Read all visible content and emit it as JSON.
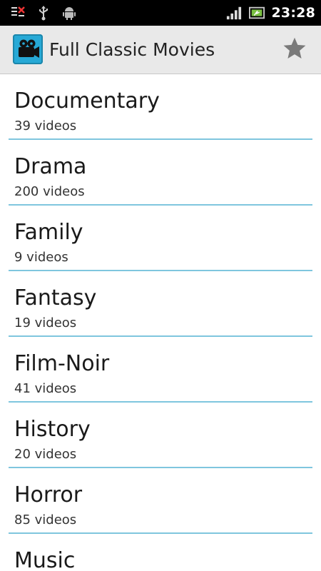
{
  "status_bar": {
    "time": "23:28",
    "icons": [
      "notification-icon",
      "usb-icon",
      "android-debug-icon",
      "signal-icon",
      "battery-icon"
    ]
  },
  "action_bar": {
    "title": "Full Classic Movies",
    "app_icon": "movie-camera-icon",
    "favorite_icon": "star-icon"
  },
  "colors": {
    "accent_divider": "#7fc6de",
    "app_icon_bg": "#27a9d6",
    "action_bar_bg": "#e9e9e9"
  },
  "categories": [
    {
      "name": "Documentary",
      "count": "39 videos"
    },
    {
      "name": "Drama",
      "count": "200 videos"
    },
    {
      "name": "Family",
      "count": "9 videos"
    },
    {
      "name": "Fantasy",
      "count": "19 videos"
    },
    {
      "name": "Film-Noir",
      "count": "41 videos"
    },
    {
      "name": "History",
      "count": "20 videos"
    },
    {
      "name": "Horror",
      "count": "85 videos"
    },
    {
      "name": "Music",
      "count": ""
    }
  ]
}
